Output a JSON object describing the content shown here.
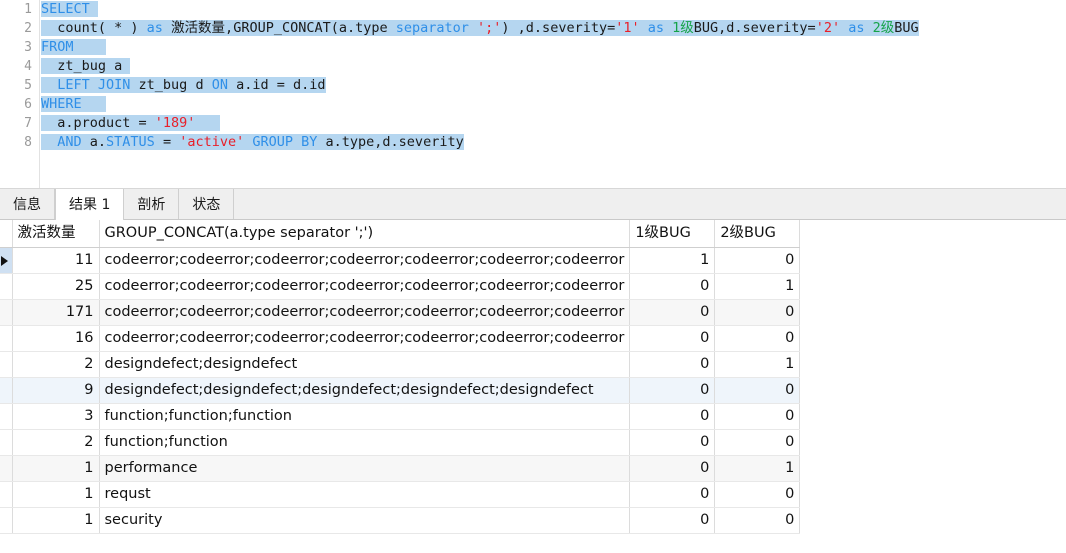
{
  "editor": {
    "line_numbers": [
      "1",
      "2",
      "3",
      "4",
      "5",
      "6",
      "7",
      "8"
    ],
    "lines": [
      "SELECT",
      "  count( * ) as 激活数量,GROUP_CONCAT(a.type separator ';') ,d.severity='1' as 1级BUG,d.severity='2' as 2级BUG",
      "FROM",
      "  zt_bug a",
      "  LEFT JOIN zt_bug d ON a.id = d.id",
      "WHERE",
      "  a.product = '189'",
      "  AND a.STATUS = 'active' GROUP BY a.type,d.severity"
    ],
    "colors": {
      "selection": "#b5d6f0",
      "keyword": "#2f8fe8",
      "string": "#e8202a",
      "alias": "#16a34a",
      "text": "#1a1a1a",
      "gutter_text": "#9a9a9a"
    }
  },
  "tabs": [
    {
      "label": "信息",
      "active": false
    },
    {
      "label": "结果 1",
      "active": true
    },
    {
      "label": "剖析",
      "active": false
    },
    {
      "label": "状态",
      "active": false
    }
  ],
  "result_grid": {
    "columns": [
      "激活数量",
      "GROUP_CONCAT(a.type separator ';')",
      "1级BUG",
      "2级BUG"
    ],
    "rows": [
      {
        "count": "11",
        "concat": "codeerror;codeerror;codeerror;codeerror;codeerror;codeerror;codeerror",
        "b1": "1",
        "b2": "0"
      },
      {
        "count": "25",
        "concat": "codeerror;codeerror;codeerror;codeerror;codeerror;codeerror;codeerror",
        "b1": "0",
        "b2": "1"
      },
      {
        "count": "171",
        "concat": "codeerror;codeerror;codeerror;codeerror;codeerror;codeerror;codeerror",
        "b1": "0",
        "b2": "0"
      },
      {
        "count": "16",
        "concat": "codeerror;codeerror;codeerror;codeerror;codeerror;codeerror;codeerror",
        "b1": "0",
        "b2": "0"
      },
      {
        "count": "2",
        "concat": "designdefect;designdefect",
        "b1": "0",
        "b2": "1"
      },
      {
        "count": "9",
        "concat": "designdefect;designdefect;designdefect;designdefect;designdefect",
        "b1": "0",
        "b2": "0"
      },
      {
        "count": "3",
        "concat": "function;function;function",
        "b1": "0",
        "b2": "0"
      },
      {
        "count": "2",
        "concat": "function;function",
        "b1": "0",
        "b2": "0"
      },
      {
        "count": "1",
        "concat": "performance",
        "b1": "0",
        "b2": "1"
      },
      {
        "count": "1",
        "concat": "requst",
        "b1": "0",
        "b2": "0"
      },
      {
        "count": "1",
        "concat": "security",
        "b1": "0",
        "b2": "0"
      }
    ],
    "current_row_index": 0,
    "selected_column": "激活数量",
    "row_marker_icon": "play-triangle-icon"
  }
}
